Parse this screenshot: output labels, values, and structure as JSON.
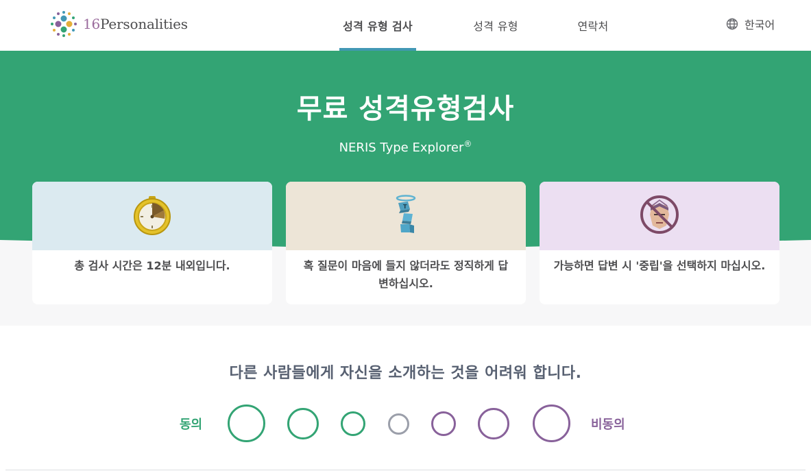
{
  "header": {
    "logo_number": "16",
    "logo_word": "Personalities",
    "nav": {
      "test": "성격 유형 검사",
      "types": "성격 유형",
      "contact": "연락처"
    },
    "language": "한국어",
    "language_icon": "globe-icon"
  },
  "hero": {
    "title": "무료 성격유형검사",
    "subtitle": "NERIS Type Explorer",
    "subtitle_mark": "®",
    "background_color": "#33a474"
  },
  "cards": [
    {
      "icon": "stopwatch-icon",
      "text": "총 검사 시간은 12분 내외입니다."
    },
    {
      "icon": "angel-blocks-icon",
      "text": "혹 질문이 마음에 들지 않더라도 정직하게 답변하십시오."
    },
    {
      "icon": "no-neutral-face-icon",
      "text": "가능하면 답변 시 '중립'을 선택하지 마십시오."
    }
  ],
  "question": {
    "text": "다른 사람들에게 자신을 소개하는 것을 어려워 합니다.",
    "agree_label": "동의",
    "disagree_label": "비동의",
    "agree_color": "#33a474",
    "disagree_color": "#88619a",
    "neutral_color": "#9b9faa"
  }
}
